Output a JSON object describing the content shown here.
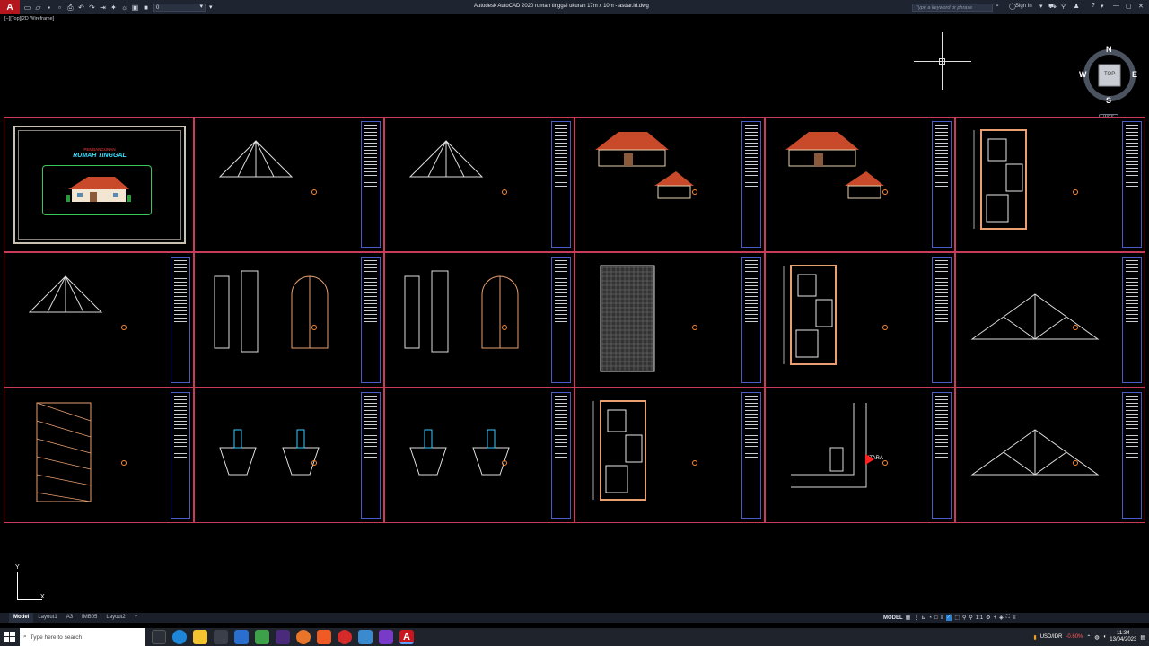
{
  "app": {
    "title": "Autodesk AutoCAD 2020   rumah tinggal ukuran 17m x 10m - asdar.id.dwg",
    "logo": "A",
    "layer_value": "0",
    "search_placeholder": "Type a keyword or phrase",
    "sign_in": "Sign In"
  },
  "viewport": {
    "label": "[−][Top][2D Wireframe]"
  },
  "viewcube": {
    "n": "N",
    "s": "S",
    "e": "E",
    "w": "W",
    "face": "TOP",
    "wcs": "WCS"
  },
  "axes": {
    "x": "X",
    "y": "Y"
  },
  "cover": {
    "subtitle": "PEMBANGUNAN",
    "title": "RUMAH TINGGAL"
  },
  "annotations": {
    "north": "UTARA"
  },
  "layout_tabs": [
    "Model",
    "Layout1",
    "A3",
    "IMB05",
    "Layout2",
    "+"
  ],
  "status": {
    "model": "MODEL",
    "scale": "1:1"
  },
  "taskbar": {
    "search_placeholder": "Type here to search",
    "currency": "USD/IDR",
    "change": "-0.60%",
    "time": "11:34",
    "date": "13/04/2023"
  },
  "colors": {
    "sheet_border": "#c83c5a",
    "title_block": "#4a5cc8",
    "roof": "#c84a2a",
    "brand": "#b3161c"
  }
}
